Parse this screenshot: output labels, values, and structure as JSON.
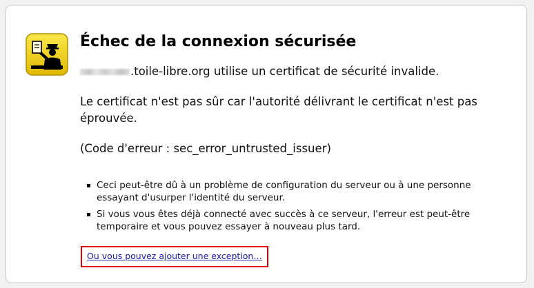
{
  "error": {
    "title": "Échec de la connexion sécurisée",
    "domain_suffix": ".toile-libre.org utilise un certificat de sécurité invalide.",
    "reason": "Le certificat n'est pas sûr car l'autorité délivrant le certificat n'est pas éprouvée.",
    "code": "(Code d'erreur : sec_error_untrusted_issuer)"
  },
  "details": {
    "items": [
      "Ceci peut-être dû à un problème de configuration du serveur ou à une personne essayant d'usurper l'identité du serveur.",
      "Si vous vous êtes déjà connecté avec succès à ce serveur, l'erreur est peut-être temporaire et vous pouvez essayer à nouveau plus tard."
    ]
  },
  "actions": {
    "exception_label": "Ou vous pouvez ajouter une exception…"
  },
  "colors": {
    "highlight_border": "#e20000",
    "link": "#1a1aa6",
    "icon_yellow": "#f4d400"
  },
  "icons": {
    "main": "certificate-officer-icon"
  }
}
